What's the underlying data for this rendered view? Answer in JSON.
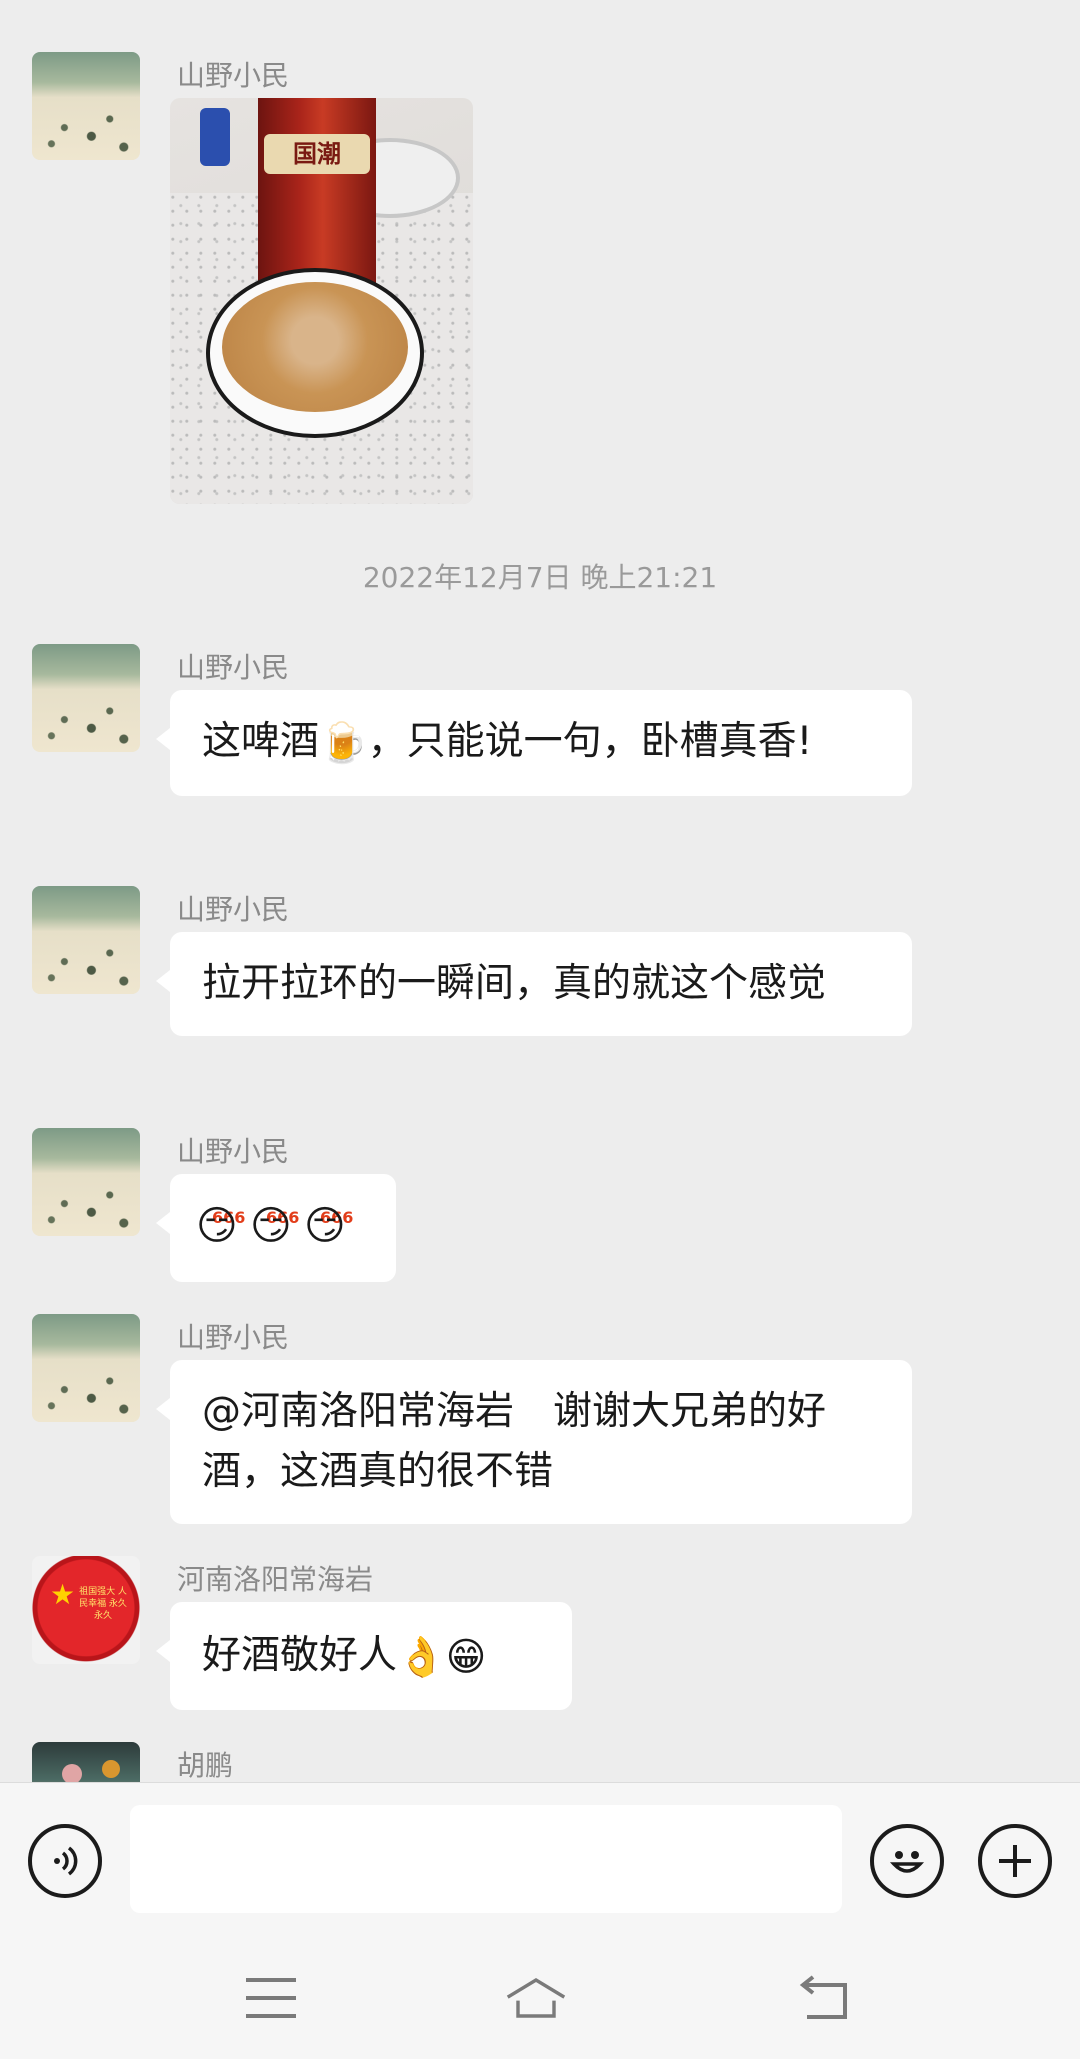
{
  "chat": {
    "messages": [
      {
        "sender": "山野小民",
        "type": "image",
        "image_desc": "beer-can-and-bowl-photo",
        "can_label": "国潮"
      },
      {
        "sender": "山野小民",
        "text_parts": [
          "这啤酒",
          "，只能说一句，卧槽真香!"
        ],
        "emoji": [
          "🍺"
        ]
      },
      {
        "sender": "山野小民",
        "text": "拉开拉环的一瞬间，真的就这个感觉"
      },
      {
        "sender": "山野小民",
        "sticker_label": "666",
        "emoji": [
          "😏",
          "😏",
          "😏"
        ]
      },
      {
        "sender": "山野小民",
        "text": "@河南洛阳常海岩　谢谢大兄弟的好酒，这酒真的很不错"
      },
      {
        "sender": "河南洛阳常海岩",
        "text": "好酒敬好人",
        "emoji": [
          "👌",
          "😁"
        ]
      },
      {
        "sender": "胡鹏"
      }
    ],
    "timestamp": "2022年12月7日 晚上21:21",
    "avatar_red_text": "祖国强大 人民幸福 永久永久"
  },
  "input_bar": {
    "voice_icon": "voice-icon",
    "emoji_icon": "smiley-icon",
    "plus_icon": "plus-icon",
    "text_value": ""
  },
  "nav_bar": {
    "menu_icon": "menu-icon",
    "home_icon": "home-icon",
    "back_icon": "back-icon"
  },
  "colors": {
    "background": "#ededed",
    "bubble": "#ffffff",
    "name_text": "#8a8a8a"
  }
}
